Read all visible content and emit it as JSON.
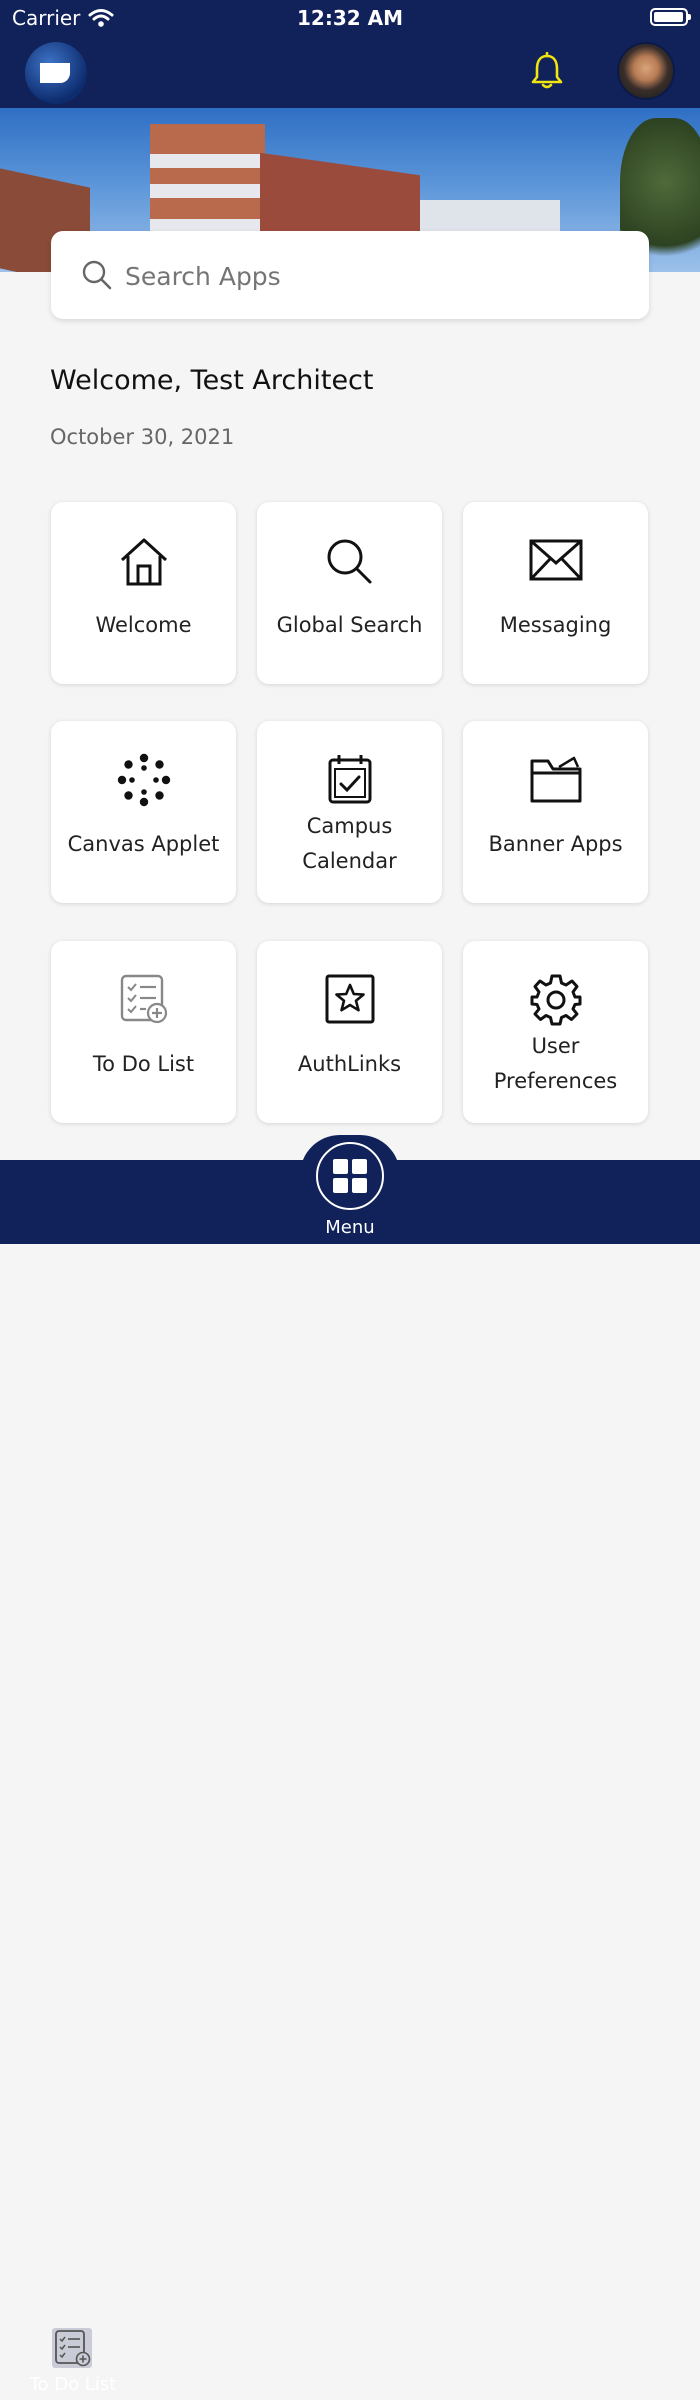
{
  "status_bar": {
    "carrier": "Carrier",
    "time": "12:32 AM",
    "battery_level": 0.95
  },
  "header": {
    "logo_icon": "university-logo",
    "notifications_icon": "bell-icon",
    "avatar": "user-avatar"
  },
  "search": {
    "placeholder": "Search Apps",
    "value": ""
  },
  "greeting": {
    "welcome": "Welcome, Test Architect",
    "date": "October 30, 2021"
  },
  "tiles": [
    {
      "label": "Welcome",
      "icon": "home-icon"
    },
    {
      "label": "Global Search",
      "icon": "search-icon"
    },
    {
      "label": "Messaging",
      "icon": "envelope-icon"
    },
    {
      "label": "Canvas Applet",
      "icon": "canvas-icon"
    },
    {
      "label": "Campus Calendar",
      "icon": "calendar-icon"
    },
    {
      "label": "Banner Apps",
      "icon": "folder-icon"
    },
    {
      "label": "To Do List",
      "icon": "todo-icon"
    },
    {
      "label": "AuthLinks",
      "icon": "star-box-icon"
    },
    {
      "label": "User Preferences",
      "icon": "gear-icon"
    }
  ],
  "bottom_nav": {
    "todo_label": "To Do List",
    "menu_label": "Menu"
  },
  "colors": {
    "navy": "#11225a",
    "bell": "#f2e40e",
    "background": "#f5f5f5"
  }
}
